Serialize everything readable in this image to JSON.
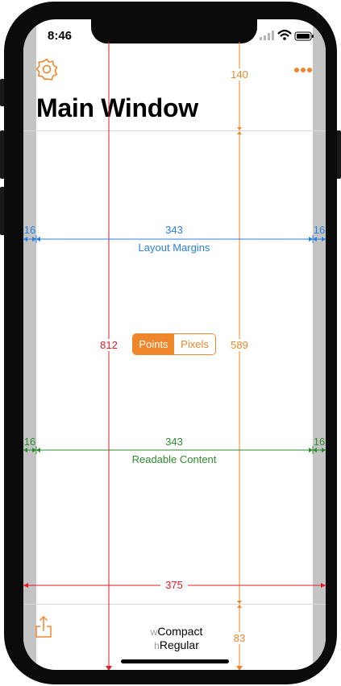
{
  "status_bar": {
    "time": "8:46"
  },
  "toolbar": {
    "settings_icon": "gear-icon",
    "more_icon": "ellipsis-icon",
    "share_icon": "share-icon"
  },
  "nav": {
    "title": "Main Window"
  },
  "measurements": {
    "top_bar_height": "140",
    "layout_margin_left": "16",
    "layout_margin_width": "343",
    "layout_margin_right": "16",
    "layout_margins_label": "Layout Margins",
    "screen_height": "812",
    "content_height": "589",
    "readable_left": "16",
    "readable_width": "343",
    "readable_right": "16",
    "readable_label": "Readable Content",
    "screen_width": "375",
    "bottom_bar_height": "83"
  },
  "units_segment": {
    "options": [
      "Points",
      "Pixels"
    ],
    "selected": "Points"
  },
  "size_class": {
    "w_prefix": "w",
    "w_value": "Compact",
    "h_prefix": "h",
    "h_value": "Regular"
  },
  "colors": {
    "accent": "#f0862b",
    "layout": "#2b7fe0",
    "readable": "#2e8b2e",
    "screen": "#e31b23"
  }
}
